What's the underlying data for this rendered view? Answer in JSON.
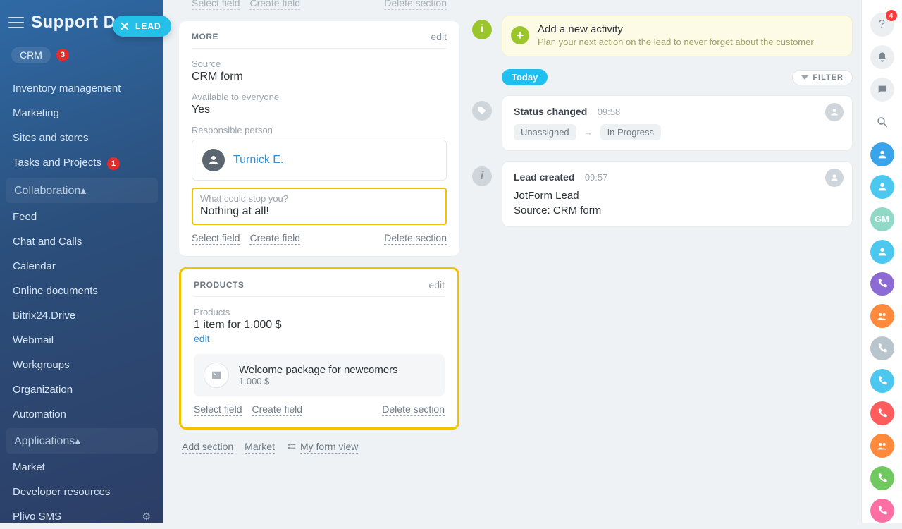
{
  "brand": "Support DA",
  "lead_chip": "LEAD",
  "sidebar": {
    "crm": {
      "label": "CRM",
      "badge": "3"
    },
    "items": [
      {
        "label": "Inventory management"
      },
      {
        "label": "Marketing"
      },
      {
        "label": "Sites and stores"
      },
      {
        "label": "Tasks and Projects",
        "badge": "1"
      }
    ],
    "collab_label": "Collaboration",
    "collab_items": [
      {
        "label": "Feed"
      },
      {
        "label": "Chat and Calls"
      },
      {
        "label": "Calendar"
      },
      {
        "label": "Online documents"
      },
      {
        "label": "Bitrix24.Drive"
      },
      {
        "label": "Webmail"
      },
      {
        "label": "Workgroups"
      },
      {
        "label": "Organization"
      },
      {
        "label": "Automation"
      }
    ],
    "apps_label": "Applications",
    "app_items": [
      {
        "label": "Market"
      },
      {
        "label": "Developer resources"
      },
      {
        "label": "Plivo SMS"
      }
    ]
  },
  "form": {
    "top_stub": {
      "sel": "Select field",
      "cre": "Create field",
      "del": "Delete section"
    },
    "more": {
      "title": "MORE",
      "edit": "edit",
      "source_label": "Source",
      "source_value": "CRM form",
      "avail_label": "Available to everyone",
      "avail_value": "Yes",
      "resp_label": "Responsible person",
      "resp_value": "Turnick E.",
      "stop_label": "What could stop you?",
      "stop_value": "Nothing at all!",
      "select_field": "Select field",
      "create_field": "Create field",
      "delete_section": "Delete section"
    },
    "products": {
      "title": "PRODUCTS",
      "edit": "edit",
      "list_label": "Products",
      "summary": "1 item for 1.000 $",
      "edit_link": "edit",
      "item_name": "Welcome package for newcomers",
      "item_price": "1.000 $",
      "select_field": "Select field",
      "create_field": "Create field",
      "delete_section": "Delete section"
    },
    "bottom": {
      "add_section": "Add section",
      "market": "Market",
      "form_view": "My form view"
    }
  },
  "timeline": {
    "banner_title": "Add a new activity",
    "banner_sub": "Plan your next action on the lead to never forget about the customer",
    "today": "Today",
    "filter": "FILTER",
    "status": {
      "title": "Status changed",
      "time": "09:58",
      "from": "Unassigned",
      "to": "In Progress"
    },
    "created": {
      "title": "Lead created",
      "time": "09:57",
      "line1": "JotForm Lead",
      "line2": "Source: CRM form"
    }
  },
  "rail": {
    "badge4": "4",
    "gm": "GM"
  }
}
